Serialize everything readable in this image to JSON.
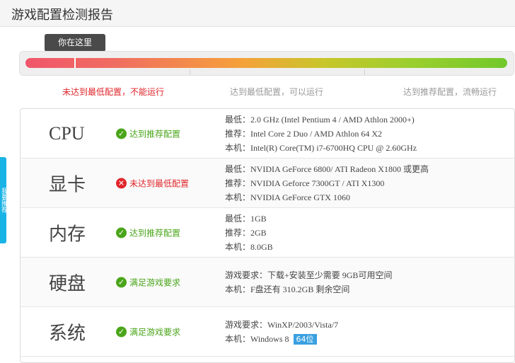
{
  "page": {
    "title": "游戏配置检测报告"
  },
  "meter": {
    "you_are_here": "你在这里",
    "levels": [
      "未达到最低配置，不能运行",
      "达到最低配置，可以运行",
      "达到推荐配置，流畅运行"
    ]
  },
  "side_tab": {
    "label": "我要推荐"
  },
  "rows": [
    {
      "name": "CPU",
      "status": "达到推荐配置",
      "status_type": "ok",
      "lines": [
        "最低：2.0 GHz (Intel Pentium 4 / AMD Athlon 2000+)",
        "推荐：Intel Core 2 Duo / AMD Athlon 64 X2",
        "本机：Intel(R) Core(TM) i7-6700HQ CPU @ 2.60GHz"
      ]
    },
    {
      "name": "显卡",
      "status": "未达到最低配置",
      "status_type": "fail",
      "lines": [
        "最低：NVIDIA GeForce 6800/ ATI Radeon X1800 或更高",
        "推荐：NVIDIA Geforce 7300GT / ATI X1300",
        "本机：NVIDIA GeForce GTX 1060"
      ]
    },
    {
      "name": "内存",
      "status": "达到推荐配置",
      "status_type": "ok",
      "lines": [
        "最低：1GB",
        "推荐：2GB",
        "本机：8.0GB"
      ]
    },
    {
      "name": "硬盘",
      "status": "满足游戏要求",
      "status_type": "ok",
      "lines": [
        "游戏要求：下载+安装至少需要 9GB可用空间",
        "本机：F盘还有 310.2GB 剩余空间"
      ]
    },
    {
      "name": "系统",
      "status": "满足游戏要求",
      "status_type": "ok",
      "lines": [
        "游戏要求：WinXP/2003/Vista/7",
        "本机：Windows 8"
      ],
      "badge": "64位"
    }
  ],
  "colors": {
    "ok": "#4aa51a",
    "fail": "#e0262b",
    "accent": "#3aa0e0"
  },
  "icons": {
    "ok": "check-circle-icon",
    "fail": "x-circle-icon"
  }
}
